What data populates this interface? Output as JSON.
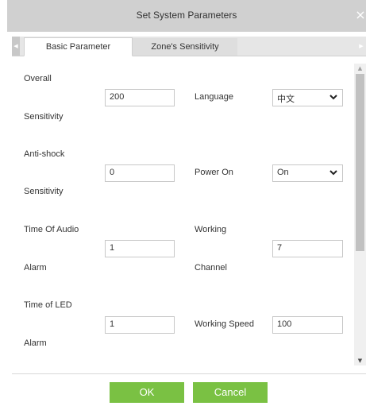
{
  "dialog": {
    "title": "Set System Parameters",
    "close_glyph": "×"
  },
  "tabs": [
    {
      "label": "Basic Parameter",
      "active": true
    },
    {
      "label": "Zone's Sensitivity",
      "active": false
    }
  ],
  "tab_scroll": {
    "left_glyph": "◀",
    "right_glyph": "▶"
  },
  "form": {
    "overall": {
      "label_line1": "Overall",
      "label_line2": "Sensitivity",
      "value": "200"
    },
    "language": {
      "label": "Language",
      "value": "中文"
    },
    "antishock": {
      "label_line1": "Anti-shock",
      "label_line2": "Sensitivity",
      "value": "0"
    },
    "power_on": {
      "label": "Power On",
      "value": "On"
    },
    "audio_alarm": {
      "label_line1": "Time Of Audio",
      "label_line2": "Alarm",
      "value": "1"
    },
    "working_channel": {
      "label_line1": "Working",
      "label_line2": "Channel",
      "value": "7"
    },
    "led_alarm": {
      "label_line1": "Time of LED",
      "label_line2": "Alarm",
      "value": "1"
    },
    "working_speed": {
      "label": "Working Speed",
      "value": "100"
    }
  },
  "scrollbar": {
    "up_glyph": "▲",
    "down_glyph": "▼"
  },
  "buttons": {
    "ok": "OK",
    "cancel": "Cancel"
  },
  "colors": {
    "accent": "#7ac143",
    "titlebar": "#d0d0d0"
  }
}
